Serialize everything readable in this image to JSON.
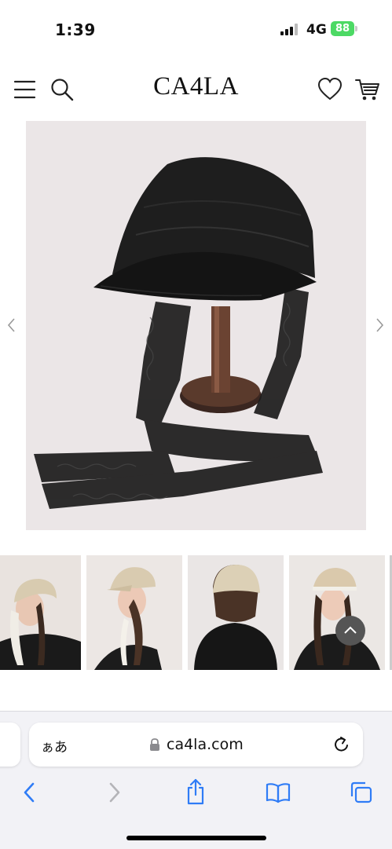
{
  "status_bar": {
    "time": "1:39",
    "network": "4G",
    "battery": "88"
  },
  "header": {
    "logo": "CA4LA",
    "icons": [
      "menu-icon",
      "search-icon",
      "heart-icon",
      "cart-icon"
    ]
  },
  "gallery": {
    "main_image": "black braided straw cap with lace ribbon on wooden stand",
    "thumbnails": [
      "model wearing beige cap with white lace ribbon",
      "model side view beige cap",
      "back view beige cap",
      "model wearing beige cap with lace"
    ]
  },
  "browser": {
    "aa_label": "ぁあ",
    "url": "ca4la.com",
    "toolbar_icons": [
      "back-icon",
      "forward-icon",
      "share-icon",
      "bookmarks-icon",
      "tabs-icon"
    ]
  },
  "colors": {
    "link_blue": "#2f7cf6",
    "battery_green": "#4cd964"
  }
}
